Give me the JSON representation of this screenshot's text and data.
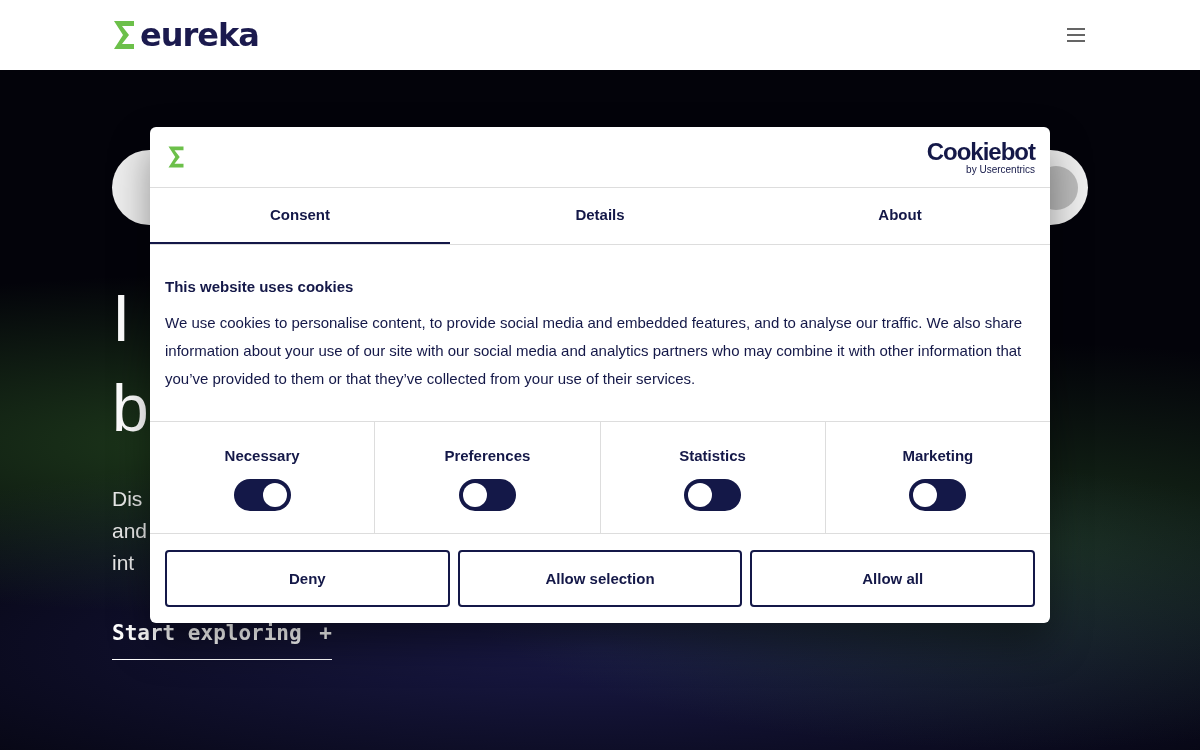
{
  "header": {
    "logo": "eureka"
  },
  "hero": {
    "heading_lines": [
      "I",
      "b"
    ],
    "text_lines": [
      "Dis",
      "and",
      "int"
    ],
    "link": "Start exploring",
    "link_icon": "+"
  },
  "dialog": {
    "brand": "Cookiebot",
    "brand_sub": "by Usercentrics",
    "tabs": [
      {
        "label": "Consent",
        "selected": true
      },
      {
        "label": "Details",
        "selected": false
      },
      {
        "label": "About",
        "selected": false
      }
    ],
    "title": "This website uses cookies",
    "body": "We use cookies to personalise content, to provide social media and embedded features, and to analyse our traffic. We also share information about your use of our site with our social media and analytics partners who may combine it with other information that you’ve provided to them or that they’ve collected from your use of their services.",
    "categories": [
      {
        "label": "Necessary",
        "checked": true
      },
      {
        "label": "Preferences",
        "checked": false
      },
      {
        "label": "Statistics",
        "checked": false
      },
      {
        "label": "Marketing",
        "checked": false
      }
    ],
    "buttons": [
      "Deny",
      "Allow selection",
      "Allow all"
    ]
  }
}
